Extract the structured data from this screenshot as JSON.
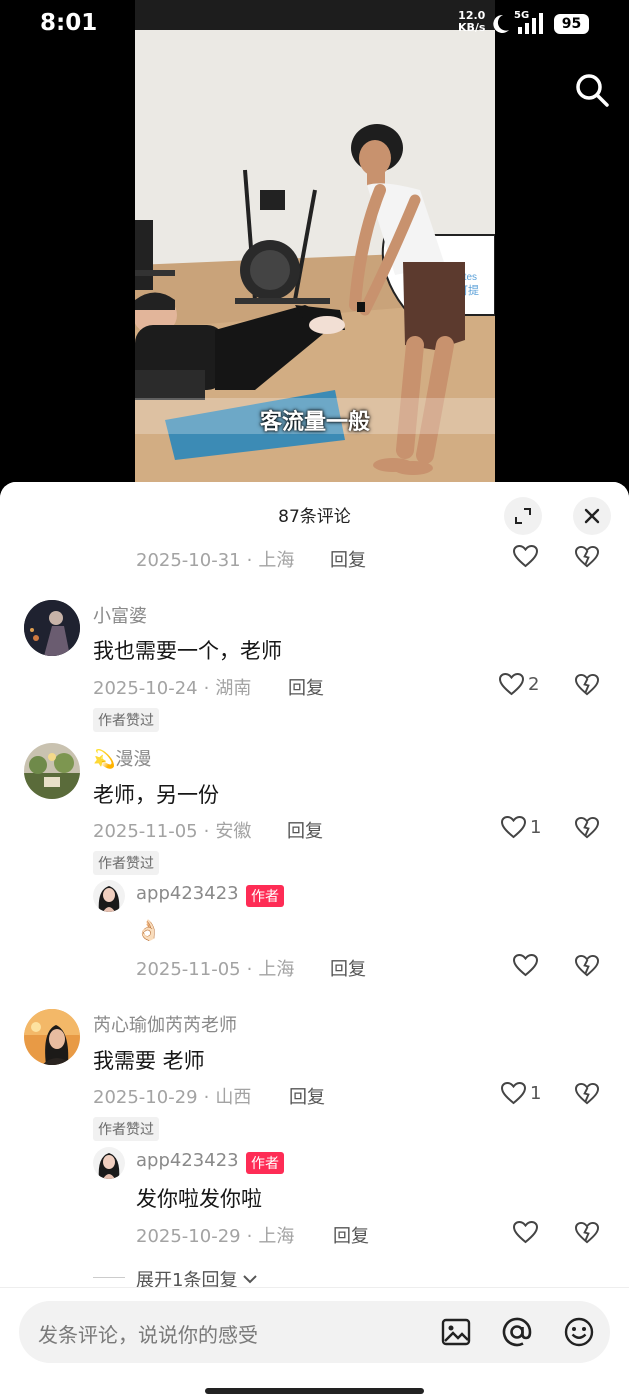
{
  "status_bar": {
    "time": "8:01",
    "net_speed_value": "12.0",
    "net_speed_unit": "KB/s",
    "network_type": "5G",
    "battery": "95"
  },
  "video": {
    "subtitle": "客流量一般",
    "signage_text": "Pilates 可提"
  },
  "comments_header": {
    "count_label": "87条评论"
  },
  "comments": [
    {
      "date": "2025-10-31",
      "location": "上海",
      "reply_label": "回复",
      "likes": ""
    },
    {
      "username": "小富婆",
      "text": "我也需要一个，老师",
      "date": "2025-10-24",
      "location": "湖南",
      "reply_label": "回复",
      "likes": "2",
      "author_liked": "作者赞过"
    },
    {
      "username": "💫漫漫",
      "text": "老师，另一份",
      "date": "2025-11-05",
      "location": "安徽",
      "reply_label": "回复",
      "likes": "1",
      "author_liked": "作者赞过",
      "reply": {
        "username": "app423423",
        "badge": "作者",
        "text": "👌🏻",
        "date": "2025-11-05",
        "location": "上海",
        "reply_label": "回复",
        "likes": ""
      }
    },
    {
      "username": "芮心瑜伽芮芮老师",
      "text": "我需要 老师",
      "date": "2025-10-29",
      "location": "山西",
      "reply_label": "回复",
      "likes": "1",
      "author_liked": "作者赞过",
      "reply": {
        "username": "app423423",
        "badge": "作者",
        "text": "发你啦发你啦",
        "date": "2025-10-29",
        "location": "上海",
        "reply_label": "回复",
        "likes": ""
      },
      "expand_label": "展开1条回复"
    }
  ],
  "meta_separator": "·",
  "input": {
    "placeholder": "发条评论，说说你的感受"
  },
  "colors": {
    "author_badge": "#fe2c55",
    "sheet_bg": "#ffffff",
    "input_bg": "#f2f2f2"
  },
  "icons": [
    "search-icon",
    "expand-icon",
    "close-icon",
    "heart-icon",
    "dislike-heart-icon",
    "image-icon",
    "at-icon",
    "emoji-icon",
    "chevron-down-icon"
  ]
}
